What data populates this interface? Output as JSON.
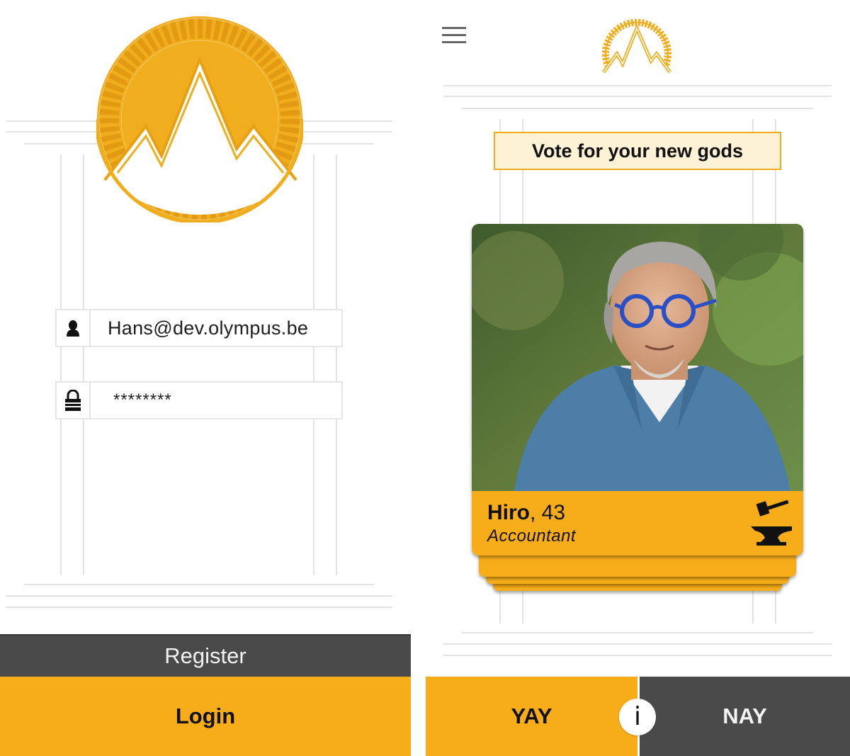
{
  "login_screen": {
    "email_value": "Hans@dev.olympus.be",
    "password_value": "********",
    "register_label": "Register",
    "login_label": "Login",
    "icons": [
      "user-icon",
      "lock-icon",
      "olympus-logo"
    ]
  },
  "vote_screen": {
    "banner_text": "Vote for your new gods",
    "candidate": {
      "name": "Hiro",
      "age_suffix": ", 43",
      "occupation": "Accountant",
      "occupation_icon": "anvil-hammer-icon"
    },
    "yay_label": "YAY",
    "nay_label": "NAY",
    "info_label": "i",
    "icons": [
      "menu-icon",
      "olympus-logo"
    ]
  },
  "colors": {
    "accent": "#f7ac19",
    "dark": "#4a4a4a",
    "banner_bg": "#fdf2d5",
    "line": "#e3e3e3"
  }
}
